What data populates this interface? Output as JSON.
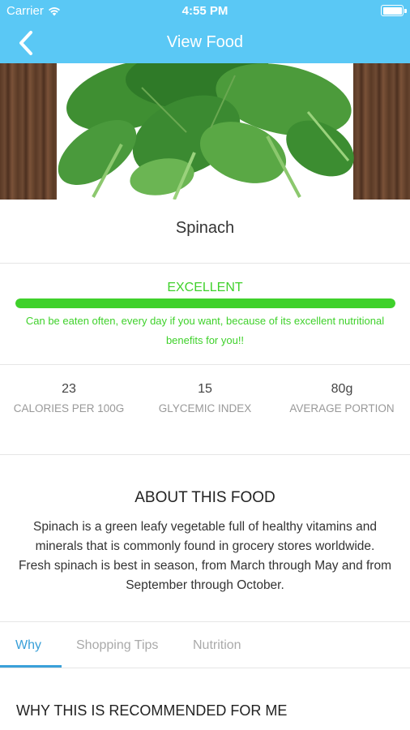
{
  "status_bar": {
    "carrier": "Carrier",
    "time": "4:55 PM",
    "wifi_icon": "wifi-icon",
    "battery_icon": "battery-icon"
  },
  "nav": {
    "title": "View Food",
    "back_icon": "chevron-left-icon"
  },
  "food": {
    "name": "Spinach",
    "image": "spinach-leaves-photo"
  },
  "rating": {
    "label": "EXCELLENT",
    "level": 1.0,
    "description": "Can be eaten often, every day if you want, because of its excellent nutritional benefits for you!!",
    "color": "#3fd12b"
  },
  "stats": [
    {
      "value": "23",
      "label": "CALORIES PER 100G"
    },
    {
      "value": "15",
      "label": "GLYCEMIC INDEX"
    },
    {
      "value": "80g",
      "label": "AVERAGE PORTION"
    }
  ],
  "about": {
    "title": "ABOUT THIS FOOD",
    "text": "Spinach is a green leafy vegetable full of healthy vitamins and minerals that is commonly found in grocery stores worldwide. Fresh spinach is best in season, from March through May and from September through October."
  },
  "tabs": [
    {
      "label": "Why",
      "active": true
    },
    {
      "label": "Shopping Tips",
      "active": false
    },
    {
      "label": "Nutrition",
      "active": false
    }
  ],
  "why_section": {
    "title": "WHY THIS IS RECOMMENDED FOR ME"
  },
  "colors": {
    "header": "#5ac8f5",
    "accent": "#3aa0d9",
    "good": "#3fd12b"
  }
}
